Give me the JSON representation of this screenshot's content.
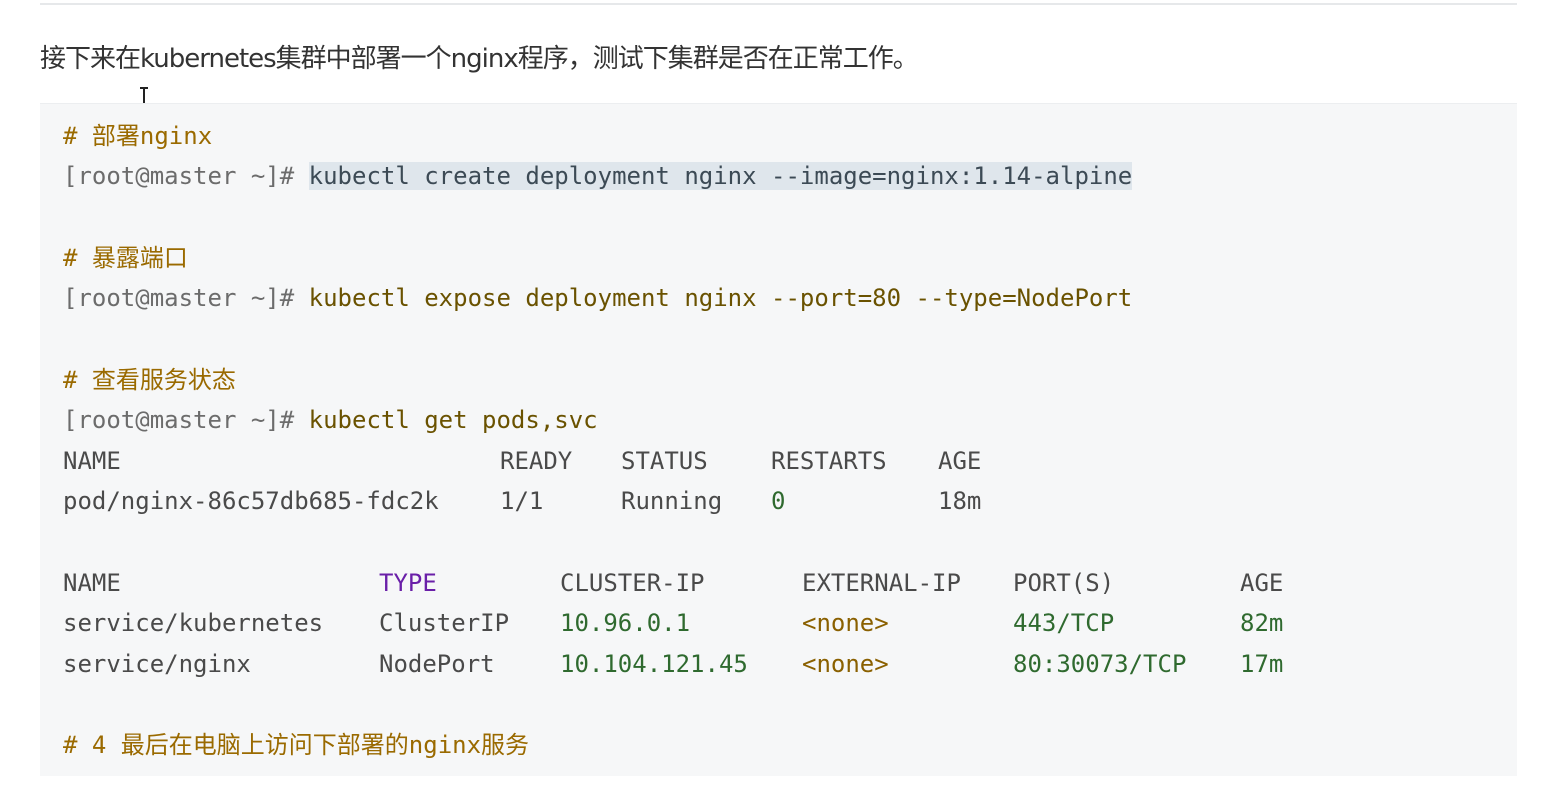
{
  "intro_text": "接下来在kubernetes集群中部署一个nginx程序，测试下集群是否在正常工作。",
  "code": {
    "comment1": "# 部署nginx",
    "prompt": "[root@master ~]#",
    "cmd1": "kubectl create deployment nginx --image=nginx:1.14-alpine",
    "comment2": "# 暴露端口",
    "cmd2": "kubectl expose deployment nginx --port=80 --type=NodePort",
    "comment3": "# 查看服务状态",
    "cmd3": "kubectl get pods,svc",
    "comment4": "# 4 最后在电脑上访问下部署的nginx服务"
  },
  "pods_table": {
    "headers": [
      "NAME",
      "READY",
      "STATUS",
      "RESTARTS",
      "AGE"
    ],
    "rows": [
      [
        "pod/nginx-86c57db685-fdc2k",
        "1/1",
        "Running",
        "0",
        "18m"
      ]
    ]
  },
  "svc_table": {
    "headers": [
      "NAME",
      "TYPE",
      "CLUSTER-IP",
      "EXTERNAL-IP",
      "PORT(S)",
      "AGE"
    ],
    "rows": [
      [
        "service/kubernetes",
        "ClusterIP",
        "10.96.0.1",
        "<none>",
        "443/TCP",
        "82m"
      ],
      [
        "service/nginx",
        "NodePort",
        "10.104.121.45",
        "<none>",
        "80:30073/TCP",
        "17m"
      ]
    ]
  },
  "colors": {
    "comment": "#9a6a00",
    "code_bg": "#f6f7f8",
    "selection": "#dfe6ec",
    "type_header": "#6a1fa8"
  }
}
